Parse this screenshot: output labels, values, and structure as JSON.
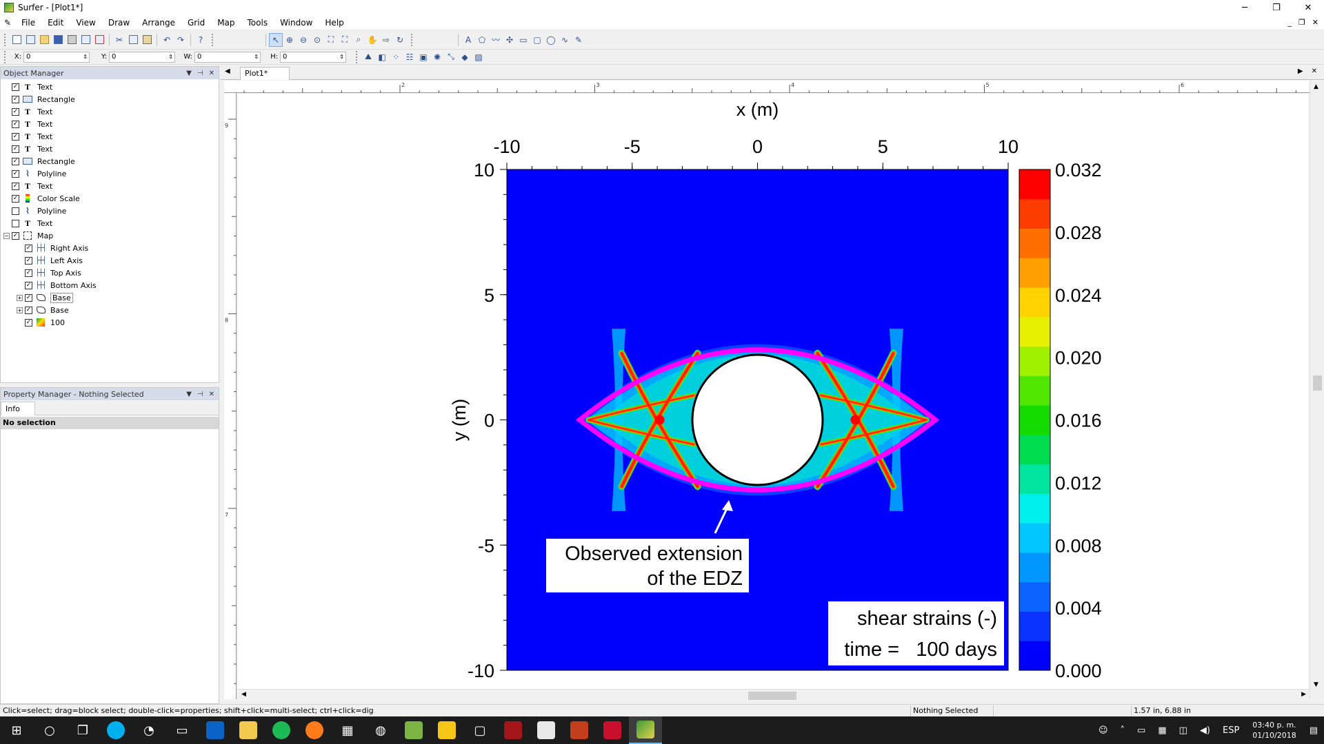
{
  "window": {
    "title": "Surfer - [Plot1*]",
    "minimize": "─",
    "restore": "❐",
    "close": "✕"
  },
  "menu": [
    "File",
    "Edit",
    "View",
    "Draw",
    "Arrange",
    "Grid",
    "Map",
    "Tools",
    "Window",
    "Help"
  ],
  "mdi_controls": {
    "minimize": "_",
    "restore": "❐",
    "close": "✕"
  },
  "coords": {
    "x_label": "X:",
    "x_value": "0",
    "y_label": "Y:",
    "y_value": "0",
    "w_label": "W:",
    "w_value": "0",
    "h_label": "H:",
    "h_value": "0"
  },
  "object_manager": {
    "title": "Object Manager",
    "items": [
      {
        "label": "Text",
        "icon": "text-icon",
        "checked": true,
        "level": 0
      },
      {
        "label": "Rectangle",
        "icon": "rectangle-icon",
        "checked": true,
        "level": 0
      },
      {
        "label": "Text",
        "icon": "text-icon",
        "checked": true,
        "level": 0
      },
      {
        "label": "Text",
        "icon": "text-icon",
        "checked": true,
        "level": 0
      },
      {
        "label": "Text",
        "icon": "text-icon",
        "checked": true,
        "level": 0
      },
      {
        "label": "Text",
        "icon": "text-icon",
        "checked": true,
        "level": 0
      },
      {
        "label": "Rectangle",
        "icon": "rectangle-icon",
        "checked": true,
        "level": 0
      },
      {
        "label": "Polyline",
        "icon": "polyline-icon",
        "checked": true,
        "level": 0
      },
      {
        "label": "Text",
        "icon": "text-icon",
        "checked": true,
        "level": 0
      },
      {
        "label": "Color Scale",
        "icon": "color-scale-icon",
        "checked": true,
        "level": 0
      },
      {
        "label": "Polyline",
        "icon": "polyline-icon",
        "checked": false,
        "level": 0
      },
      {
        "label": "Text",
        "icon": "text-icon",
        "checked": false,
        "level": 0
      },
      {
        "label": "Map",
        "icon": "map-icon",
        "checked": true,
        "level": 0,
        "expander": "−"
      },
      {
        "label": "Right Axis",
        "icon": "axis-icon",
        "checked": true,
        "level": 1
      },
      {
        "label": "Left Axis",
        "icon": "axis-icon",
        "checked": true,
        "level": 1
      },
      {
        "label": "Top Axis",
        "icon": "axis-icon",
        "checked": true,
        "level": 1
      },
      {
        "label": "Bottom Axis",
        "icon": "axis-icon",
        "checked": true,
        "level": 1
      },
      {
        "label": "Base",
        "icon": "base-map-icon",
        "checked": true,
        "level": 1,
        "expander": "+",
        "boxed": true
      },
      {
        "label": "Base",
        "icon": "base-map-icon",
        "checked": true,
        "level": 1,
        "expander": "+"
      },
      {
        "label": "100",
        "icon": "contour-map-icon",
        "checked": true,
        "level": 1
      }
    ]
  },
  "property_manager": {
    "title": "Property Manager - Nothing Selected",
    "tab": "Info",
    "no_selection": "No selection"
  },
  "document": {
    "tab": "Plot1*"
  },
  "ruler": {
    "h_marks": [
      "2",
      "3",
      "4",
      "5",
      "6"
    ],
    "v_marks": [
      "9",
      "8",
      "7"
    ]
  },
  "colors": {
    "map_bg": "#0000ff",
    "edz_outline": "#ff00ff",
    "accent": "#0078d7"
  },
  "chart_data": {
    "type": "heatmap",
    "xlabel": "x (m)",
    "ylabel": "y (m)",
    "xlim": [
      -10,
      10
    ],
    "ylim": [
      -10,
      10
    ],
    "x_ticks": [
      "-10",
      "-5",
      "0",
      "5",
      "10"
    ],
    "y_ticks": [
      "10",
      "5",
      "0",
      "-5",
      "-10"
    ],
    "colorbar": {
      "ticks": [
        "0.032",
        "0.028",
        "0.024",
        "0.020",
        "0.016",
        "0.012",
        "0.008",
        "0.004",
        "0.000"
      ],
      "range": [
        0,
        0.032
      ],
      "colors": [
        "#0000ff",
        "#0a32ff",
        "#0b64ff",
        "#0096ff",
        "#00c8ff",
        "#00f0f0",
        "#00e6a0",
        "#00dc50",
        "#14dc00",
        "#50e600",
        "#a0f000",
        "#e6f000",
        "#ffd200",
        "#ffa000",
        "#ff6e00",
        "#ff3c00",
        "#ff0000"
      ]
    },
    "tunnel": {
      "center": [
        0,
        0
      ],
      "radius": 2.6
    },
    "edz_outline": {
      "half_width": 7.1,
      "half_height": 2.8
    },
    "annotation": {
      "line1": "Observed extension",
      "line2": "of the EDZ"
    },
    "legend_box": {
      "line1": "shear strains (-)",
      "line2": "time =   100 days"
    }
  },
  "status": {
    "hint": "Click=select; drag=block select; double-click=properties; shift+click=multi-select; ctrl+click=dig",
    "selection": "Nothing Selected",
    "position": "1.57 in, 6.88 in"
  },
  "taskbar": {
    "lang": "ESP",
    "time": "03:40 p. m.",
    "date": "01/10/2018"
  }
}
